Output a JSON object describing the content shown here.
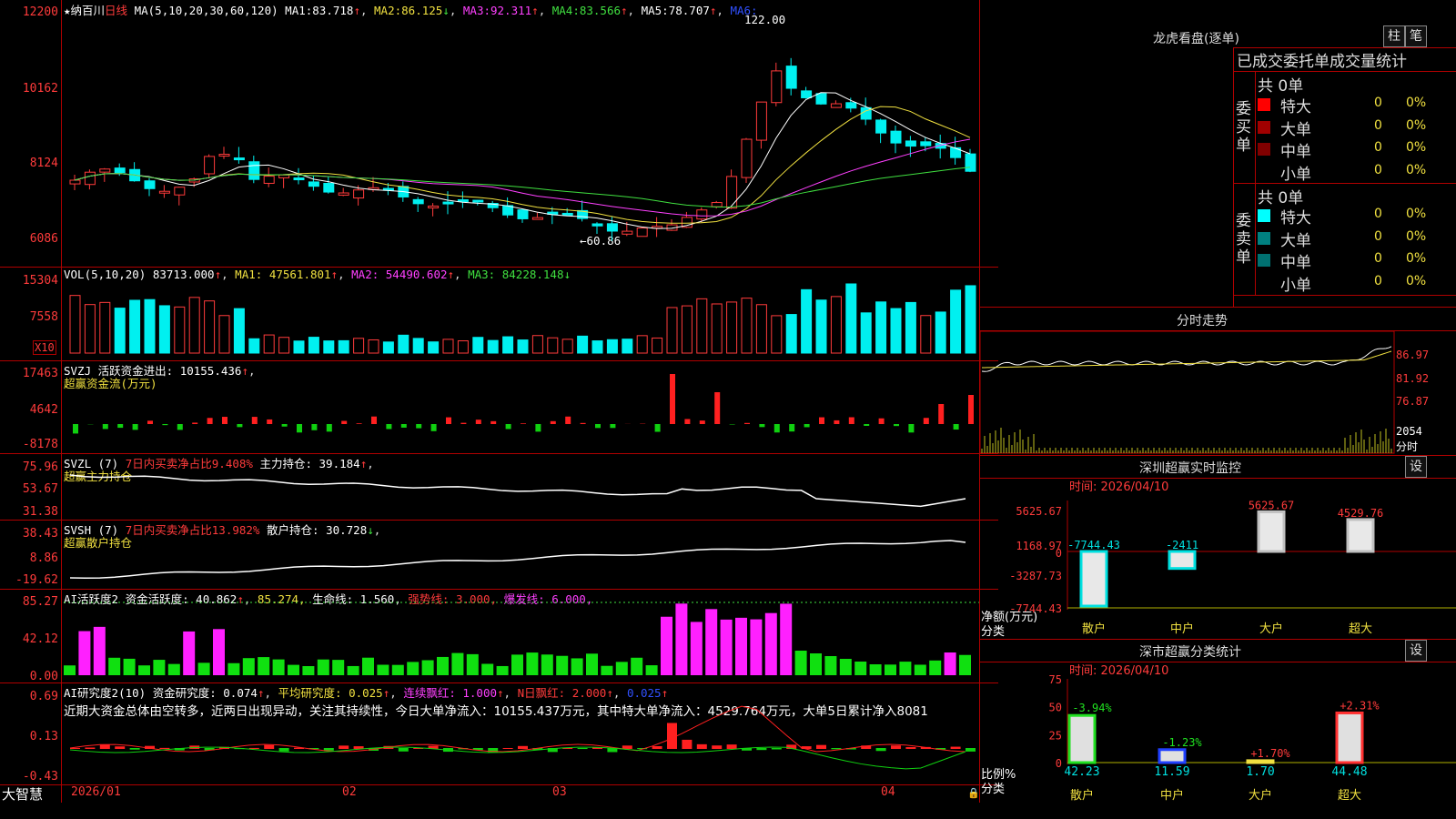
{
  "main": {
    "stock_name": "纳百川",
    "period": "日线",
    "star": "★",
    "ma_legend": "MA(5,10,20,30,60,120)",
    "ma_values": [
      {
        "label": "MA1:",
        "value": "83.718",
        "arrow": "↑"
      },
      {
        "label": "MA2:",
        "value": "86.125",
        "arrow": "↓"
      },
      {
        "label": "MA3:",
        "value": "92.311",
        "arrow": "↑"
      },
      {
        "label": "MA4:",
        "value": "83.566",
        "arrow": "↑"
      },
      {
        "label": "MA5:",
        "value": "78.707",
        "arrow": "↑"
      },
      {
        "label": "MA6:",
        "value": "",
        "arrow": ""
      }
    ],
    "y_labels": [
      "12200",
      "10162",
      "8124",
      "6086"
    ],
    "high_marker": "122.00",
    "low_marker": "←60.86"
  },
  "vol": {
    "legend": "VOL(5,10,20)",
    "value": "83713.000",
    "ma1": "47561.801",
    "ma2": "54490.602",
    "ma3": "84228.148",
    "y_labels": [
      "15304",
      "7558"
    ],
    "unit": "X10"
  },
  "svzj": {
    "legend": "SVZJ",
    "label": "活跃资金进出:",
    "value": "10155.436",
    "subtitle": "超赢资金流(万元)",
    "y_labels": [
      "17463",
      "4642",
      "-8178"
    ]
  },
  "svzl": {
    "legend": "SVZL (7)",
    "red_label": "7日内买卖净占比9.408%",
    "label": "主力持仓:",
    "value": "39.184",
    "subtitle": "超赢主力持仓",
    "y_labels": [
      "75.96",
      "53.67",
      "31.38"
    ]
  },
  "svsh": {
    "legend": "SVSH (7)",
    "red_label": "7日内买卖净占比13.982%",
    "label": "散户持仓:",
    "value": "30.728",
    "subtitle": "超赢散户持仓",
    "y_labels": [
      "38.43",
      "8.86",
      "-19.62"
    ]
  },
  "ai1": {
    "legend": "AI活跃度2",
    "label": "资金活跃度:",
    "value": "40.862",
    "v2": "85.274",
    "life_label": "生命线:",
    "life": "1.560",
    "strong": "强势线: 3.000,",
    "burst": "爆发线: 6.000,",
    "y_labels": [
      "85.27",
      "42.12",
      "0.00"
    ]
  },
  "ai2": {
    "legend": "AI研究度2(10)",
    "label": "资金研究度:",
    "value": "0.074",
    "avg_label": "平均研究度:",
    "avg": "0.025",
    "lx_label": "连续飘红:",
    "lx": "1.000",
    "n_label": "N日飘红:",
    "n": "2.000",
    "last": "0.025",
    "commentary": "近期大资金总体由空转多，近两日出现异动，关注其持续性，今日大单净流入：10155.437万元，其中特大单净流入：4529.764万元，大单5日累计净入8081",
    "y_labels": [
      "0.69",
      "0.13",
      "-0.43"
    ]
  },
  "xaxis": {
    "brand": "大智慧",
    "dates": [
      "2026/01",
      "02",
      "03",
      "04"
    ]
  },
  "right": {
    "top_title": "龙虎看盘(逐单)",
    "btn1": "柱",
    "btn2": "笔",
    "stat_title": "已成交委托单成交量统计",
    "buy_group": "委买单",
    "sell_group": "委卖单",
    "buy_total": "共 0单",
    "sell_total": "共 0单",
    "buy_rows": [
      {
        "label": "特大",
        "value": "0",
        "pct": "0%",
        "color": "#ff0000"
      },
      {
        "label": "大单",
        "value": "0",
        "pct": "0%",
        "color": "#a00000"
      },
      {
        "label": "中单",
        "value": "0",
        "pct": "0%",
        "color": "#800000"
      },
      {
        "label": "小单",
        "value": "0",
        "pct": "0%",
        "color": "#000000"
      }
    ],
    "sell_rows": [
      {
        "label": "特大",
        "value": "0",
        "pct": "0%",
        "color": "#00ffff"
      },
      {
        "label": "大单",
        "value": "0",
        "pct": "0%",
        "color": "#008080"
      },
      {
        "label": "中单",
        "value": "0",
        "pct": "0%",
        "color": "#007070"
      },
      {
        "label": "小单",
        "value": "0",
        "pct": "0%",
        "color": "#000000"
      }
    ],
    "intraday_title": "分时走势",
    "intraday_labels": [
      "86.97",
      "81.92",
      "76.87",
      "2054"
    ],
    "intraday_unit": "分时",
    "monitor_title": "深圳超赢实时监控",
    "monitor_set": "设",
    "monitor_time": "时间: 2026/04/10",
    "monitor_y": [
      "5625.67",
      "1168.97",
      "0",
      "-3287.73",
      "-7744.43"
    ],
    "monitor_ylabel": "净额(万元)",
    "monitor_xlabel": "分类",
    "monitor_cats": [
      "散户",
      "中户",
      "大户",
      "超大"
    ],
    "monitor_vals": [
      "-7744.43",
      "-2411",
      "5625.67",
      "4529.76"
    ],
    "class_title": "深市超赢分类统计",
    "class_set": "设",
    "class_time": "时间: 2026/04/10",
    "class_y": [
      "75",
      "50",
      "25",
      "0"
    ],
    "class_ylabel": "比例%",
    "class_xlabel": "分类",
    "class_cats": [
      "散户",
      "中户",
      "大户",
      "超大"
    ],
    "class_vals": [
      "42.23",
      "11.59",
      "1.70",
      "44.48"
    ],
    "class_changes": [
      "-3.94%",
      "-1.23%",
      "+1.70%",
      "+2.31%"
    ]
  }
}
